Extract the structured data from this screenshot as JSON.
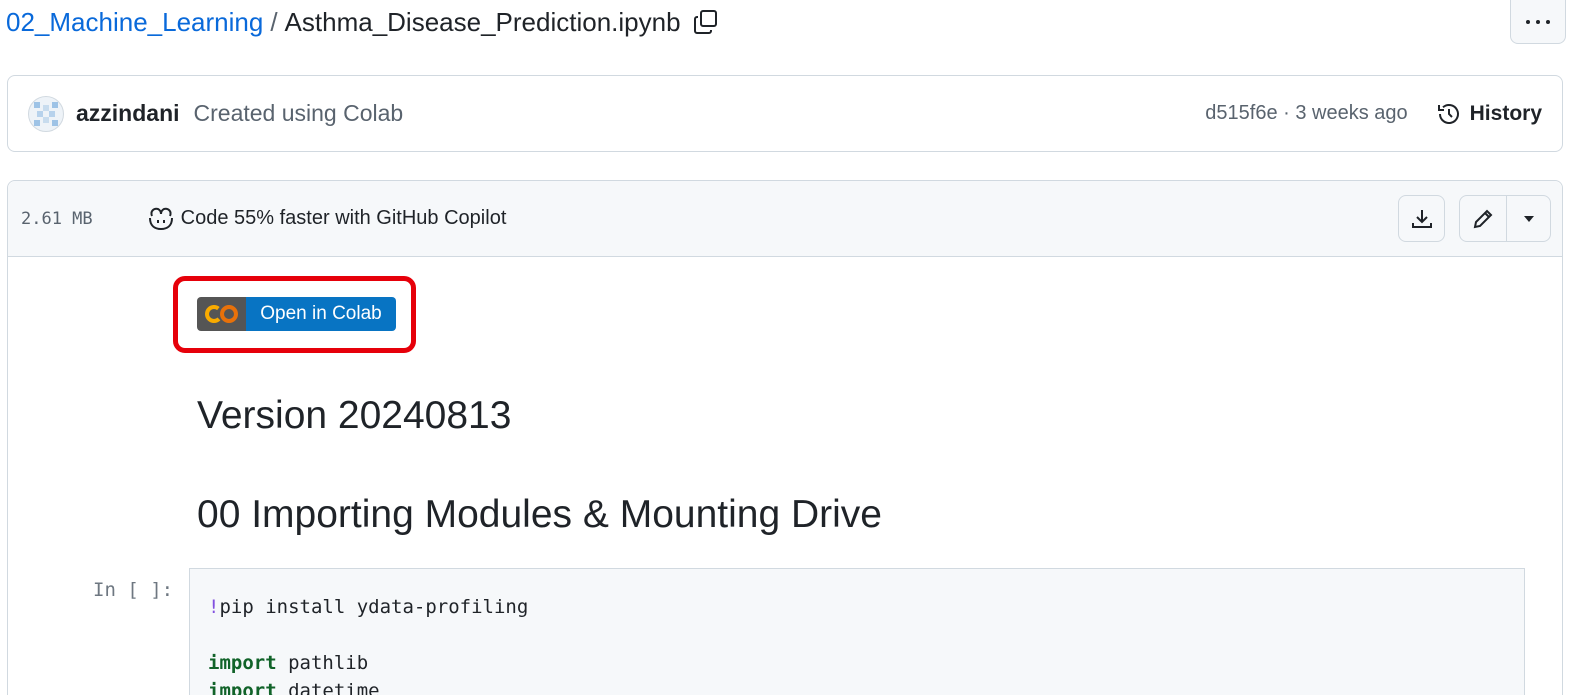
{
  "breadcrumb": {
    "folder": "02_Machine_Learning",
    "separator": "/",
    "file": "Asthma_Disease_Prediction.ipynb"
  },
  "commit": {
    "author": "azzindani",
    "message": "Created using Colab",
    "meta": "d515f6e · 3 weeks ago",
    "history_label": "History"
  },
  "file": {
    "size": "2.61 MB",
    "copilot_label": "Code 55% faster with GitHub Copilot"
  },
  "notebook": {
    "colab_badge_label": "Open in Colab",
    "colab_logo_text": "CO",
    "heading_version": "Version 20240813",
    "heading_import": "00 Importing Modules & Mounting Drive",
    "cell_prompt": "In [ ]:",
    "code": {
      "line1_bang": "!",
      "line1_rest": "pip install ydata-profiling",
      "line3_kw": "import",
      "line3_rest": " pathlib",
      "line4_kw": "import",
      "line4_rest": " datetime"
    }
  },
  "colors": {
    "link": "#0969da",
    "highlight": "#e6000a",
    "colab_blue": "#0874c3"
  },
  "icons": [
    "copy-icon",
    "more-icon",
    "avatar",
    "history-icon",
    "copilot-icon",
    "download-icon",
    "pencil-icon",
    "caret-down-icon",
    "colab-logo-icon"
  ]
}
